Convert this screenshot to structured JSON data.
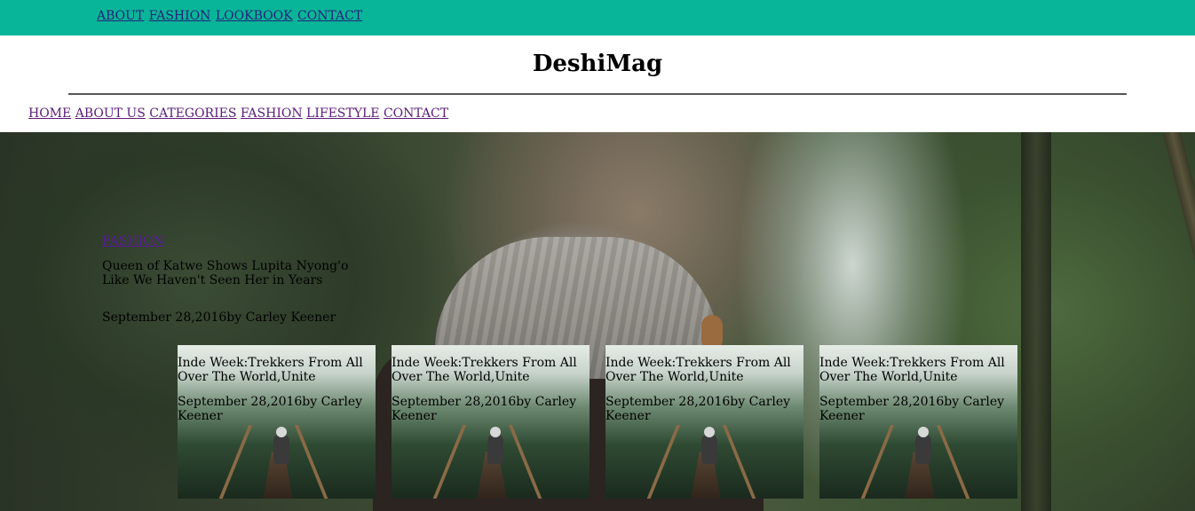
{
  "top_nav": [
    "ABOUT",
    "FASHION",
    "LOOKBOOK",
    "CONTACT"
  ],
  "brand": "DeshiMag",
  "main_nav": [
    "HOME",
    "ABOUT US",
    "CATEGORIES",
    "FASHION",
    "LIFESTYLE",
    "CONTACT"
  ],
  "featured": {
    "category": "FASHION",
    "title": "Queen of Katwe Shows Lupita Nyong'o Like We Haven't Seen Her in Years",
    "meta": "September 28,2016by Carley Keener"
  },
  "cards": [
    {
      "title": "Inde Week:Trekkers From All Over The World,Unite",
      "meta": "September 28,2016by Carley Keener"
    },
    {
      "title": "Inde Week:Trekkers From All Over The World,Unite",
      "meta": "September 28,2016by Carley Keener"
    },
    {
      "title": "Inde Week:Trekkers From All Over The World,Unite",
      "meta": "September 28,2016by Carley Keener"
    },
    {
      "title": "Inde Week:Trekkers From All Over The World,Unite",
      "meta": "September 28,2016by Carley Keener"
    }
  ],
  "colors": {
    "topbar": "#09b598",
    "link": "#5b1a7a"
  }
}
